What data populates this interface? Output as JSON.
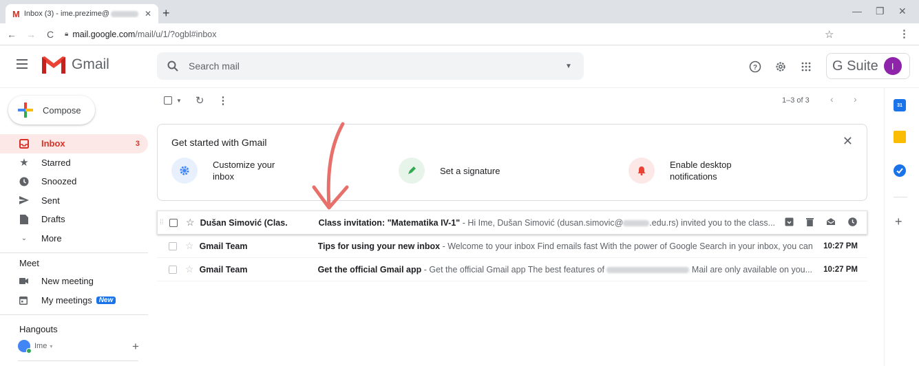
{
  "browser": {
    "tab_title": "Inbox (3) - ime.prezime@",
    "url_host": "mail.google.com",
    "url_path": "/mail/u/1/?ogbl#inbox"
  },
  "header": {
    "app_name": "Gmail",
    "search_placeholder": "Search mail",
    "gsuite_label": "G Suite",
    "avatar_letter": "I"
  },
  "sidebar": {
    "compose_label": "Compose",
    "items": [
      {
        "label": "Inbox",
        "count": "3",
        "icon": "inbox-icon"
      },
      {
        "label": "Starred",
        "icon": "star-icon"
      },
      {
        "label": "Snoozed",
        "icon": "clock-icon"
      },
      {
        "label": "Sent",
        "icon": "send-icon"
      },
      {
        "label": "Drafts",
        "icon": "draft-icon"
      },
      {
        "label": "More",
        "icon": "chevron-down-icon"
      }
    ],
    "meet": {
      "title": "Meet",
      "new_meeting": "New meeting",
      "my_meetings": "My meetings",
      "new_badge": "New"
    },
    "hangouts": {
      "title": "Hangouts",
      "user": "Ime"
    }
  },
  "toolbar": {
    "pager_text": "1–3 of 3"
  },
  "get_started": {
    "title": "Get started with Gmail",
    "tips": [
      {
        "label": "Customize your inbox",
        "line1": "Customize your",
        "line2": "inbox",
        "color": "#4285f4"
      },
      {
        "label": "Set a signature",
        "color": "#34a853"
      },
      {
        "label": "Enable desktop notifications",
        "line1": "Enable desktop",
        "line2": "notifications",
        "color": "#ea4335"
      }
    ]
  },
  "emails": [
    {
      "sender": "Dušan Simović (Clas.",
      "subject": "Class invitation: \"Matematika IV-1\"",
      "snippet_a": " - Hi Ime, Dušan Simović (dusan.simovic@",
      "snippet_b": ".edu.rs) invited you to the class...",
      "date": ""
    },
    {
      "sender": "Gmail Team",
      "subject": "Tips for using your new inbox",
      "snippet_a": " - Welcome to your inbox Find emails fast With the power of Google Search in your inbox, you can...",
      "date": "10:27 PM"
    },
    {
      "sender": "Gmail Team",
      "subject": "Get the official Gmail app",
      "snippet_a": " - Get the official Gmail app The best features of",
      "snippet_b": "Mail are only available on you...",
      "date": "10:27 PM"
    }
  ],
  "colors": {
    "accent_red": "#d93025",
    "annotation_arrow": "#e8706a",
    "avatar": "#8e24aa"
  }
}
